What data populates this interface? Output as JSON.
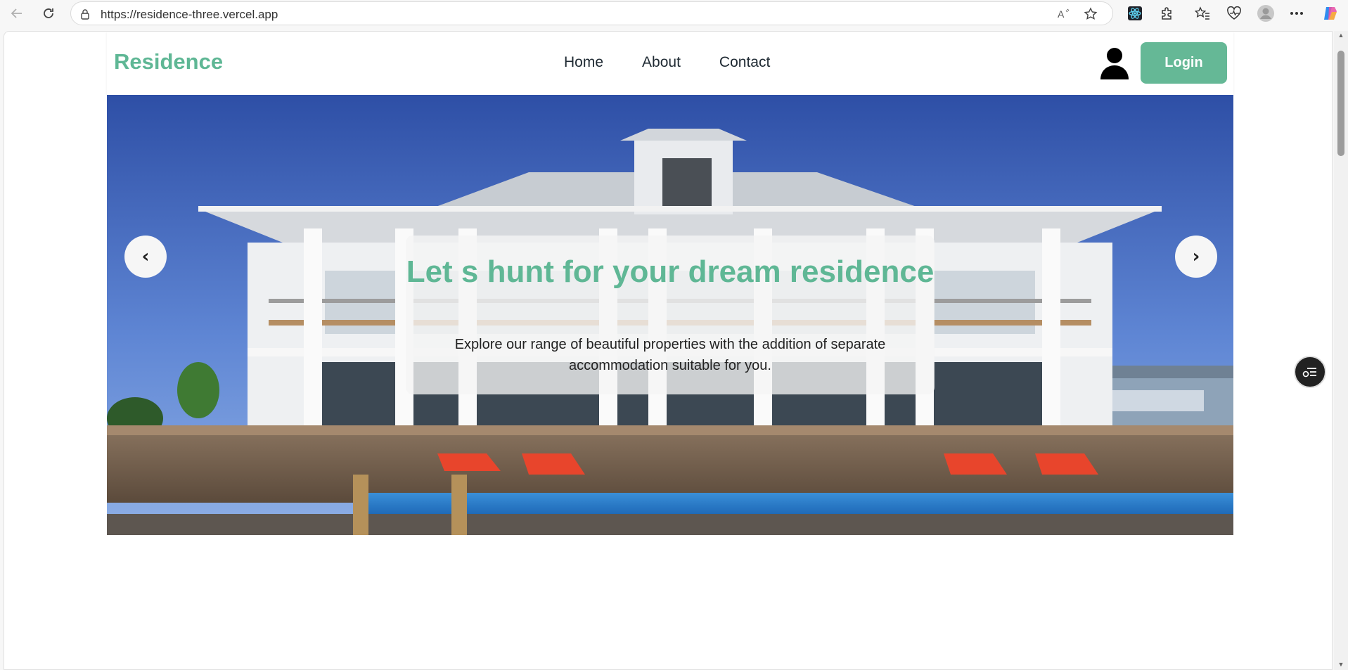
{
  "browser": {
    "url": "https://residence-three.vercel.app",
    "icons": [
      "back-icon",
      "refresh-icon",
      "lock-icon",
      "read-aloud-icon",
      "favorite-star-icon",
      "react-devtools-icon",
      "extensions-icon",
      "favorites-icon",
      "browser-essentials-icon",
      "profile-icon",
      "more-icon",
      "copilot-icon"
    ]
  },
  "header": {
    "logo": "Residence",
    "nav": [
      "Home",
      "About",
      "Contact"
    ],
    "login_label": "Login"
  },
  "hero": {
    "title": "Let s hunt for your dream residence",
    "subtitle": "Explore our range of beautiful properties with the addition of separate accommodation suitable for you.",
    "prev_symbol": "‹",
    "next_symbol": "›"
  },
  "colors": {
    "accent": "#5fb795",
    "button": "#65b896",
    "text": "#1f2a33"
  }
}
